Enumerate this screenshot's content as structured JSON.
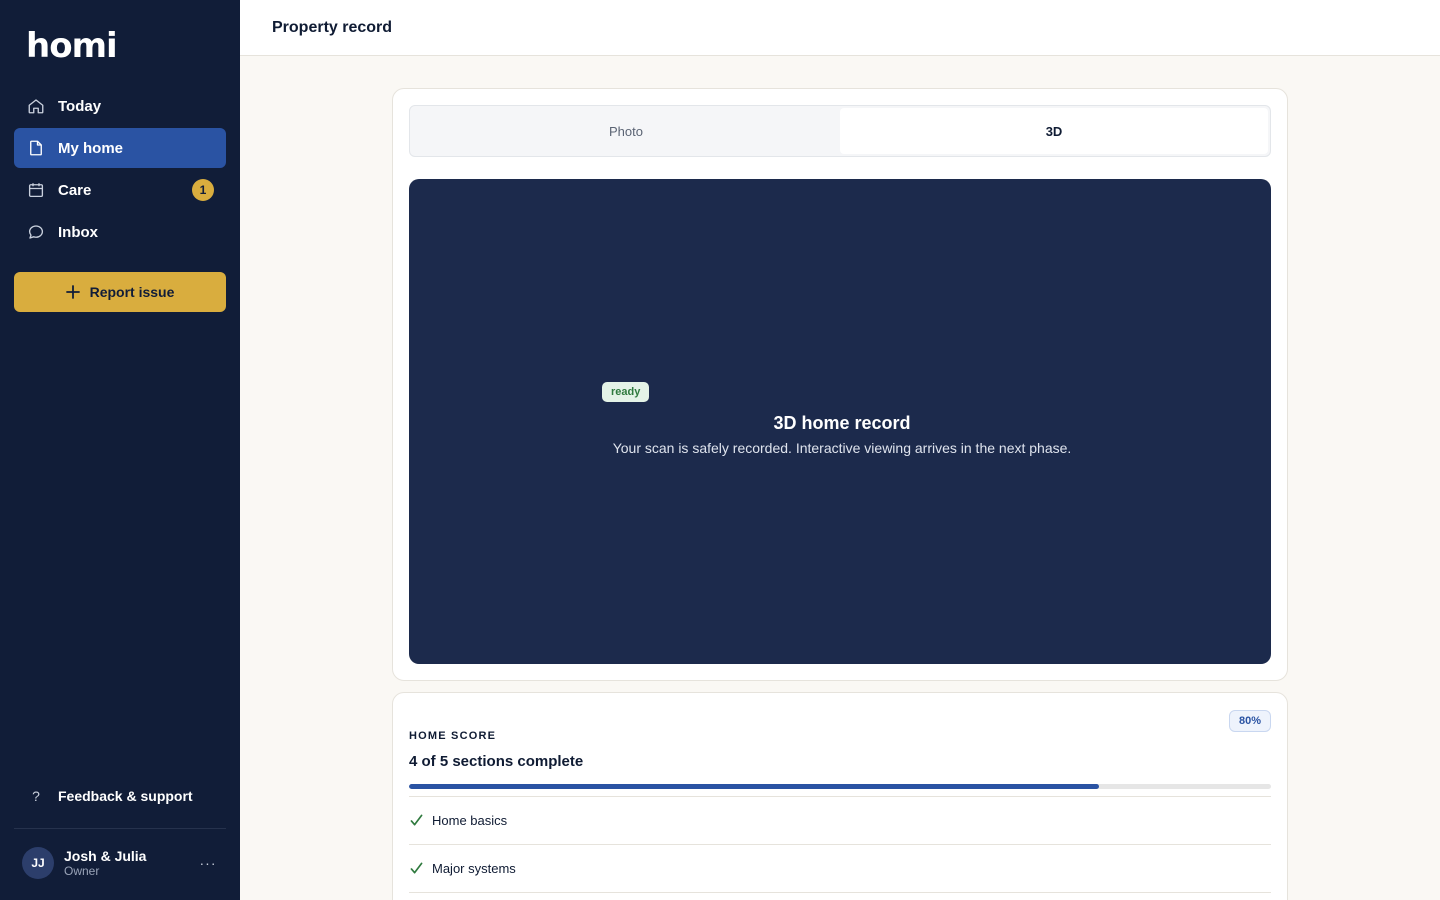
{
  "app": {
    "logo_text": "homi"
  },
  "sidebar": {
    "items": [
      {
        "label": "Today",
        "icon": "home-icon",
        "active": false
      },
      {
        "label": "My home",
        "icon": "document-icon",
        "active": true
      },
      {
        "label": "Care",
        "icon": "calendar-icon",
        "active": false,
        "badge": "1"
      },
      {
        "label": "Inbox",
        "icon": "chat-icon",
        "active": false
      }
    ],
    "report_button": "Report issue",
    "feedback": {
      "icon": "?",
      "label": "Feedback & support"
    },
    "user": {
      "initials": "JJ",
      "name": "Josh & Julia",
      "role": "Owner",
      "more": "···"
    }
  },
  "header": {
    "title": "Property record"
  },
  "viewer_card": {
    "tabs": [
      {
        "label": "Photo",
        "active": false
      },
      {
        "label": "3D",
        "active": true
      }
    ],
    "status_badge": "ready",
    "title": "3D home record",
    "subtitle": "Your scan is safely recorded. Interactive viewing arrives in the next phase."
  },
  "score_card": {
    "eyebrow": "HOME SCORE",
    "title": "4 of 5 sections complete",
    "percent_label": "80%",
    "progress": 0.8,
    "sections": [
      {
        "label": "Home basics",
        "complete": true
      },
      {
        "label": "Major systems",
        "complete": true
      }
    ]
  },
  "colors": {
    "sidebar_bg": "#111d38",
    "accent_blue": "#2a53a3",
    "accent_gold": "#d9ad3e",
    "viewer_bg": "#1c2a4c",
    "success_green": "#2f7a3e"
  }
}
